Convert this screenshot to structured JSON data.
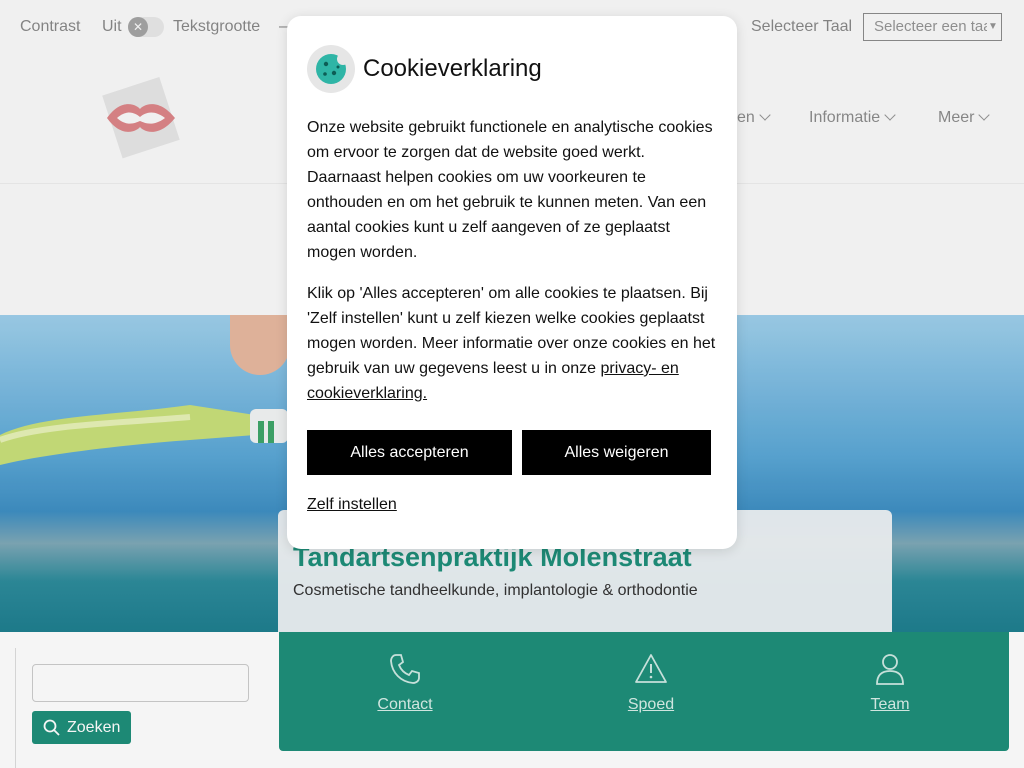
{
  "topbar": {
    "contrast_label": "Contrast",
    "contrast_state": "Uit",
    "toggle_glyph": "✕",
    "textsize_label": "Tekstgrootte",
    "textsize_dash": "–",
    "language_label": "Selecteer Taal",
    "language_select_value": "Selecteer een taal",
    "language_select_caret": "▼"
  },
  "nav": {
    "items": [
      {
        "label": "en"
      },
      {
        "label": "Informatie"
      },
      {
        "label": "Meer"
      }
    ]
  },
  "hero": {
    "title": "Tandartsenpraktijk Molenstraat",
    "subtitle": "Cosmetische tandheelkunde, implantologie & orthodontie"
  },
  "search": {
    "input_value": "",
    "button_label": "Zoeken"
  },
  "quicklinks": [
    {
      "label": "Contact",
      "icon": "phone-icon"
    },
    {
      "label": "Spoed",
      "icon": "warning-icon"
    },
    {
      "label": "Team",
      "icon": "user-icon"
    }
  ],
  "cookie_modal": {
    "title": "Cookieverklaring",
    "paragraph1": "Onze website gebruikt functionele en analytische cookies om ervoor te zorgen dat de website goed werkt. Daarnaast helpen cookies om uw voorkeuren te onthouden en om het gebruik te kunnen meten. Van een aantal cookies kunt u zelf aangeven of ze geplaatst mogen worden.",
    "paragraph2": "Klik op 'Alles accepteren' om alle cookies te plaatsen. Bij 'Zelf instellen' kunt u zelf kiezen welke cookies geplaatst mogen worden. Meer informatie over onze cookies en het gebruik van uw gegevens leest u in onze",
    "privacy_link": "privacy- en cookieverklaring.",
    "accept_label": "Alles accepteren",
    "reject_label": "Alles weigeren",
    "settings_label": "Zelf instellen"
  },
  "colors": {
    "brand_green": "#1f8f7a",
    "button_black": "#000000"
  }
}
